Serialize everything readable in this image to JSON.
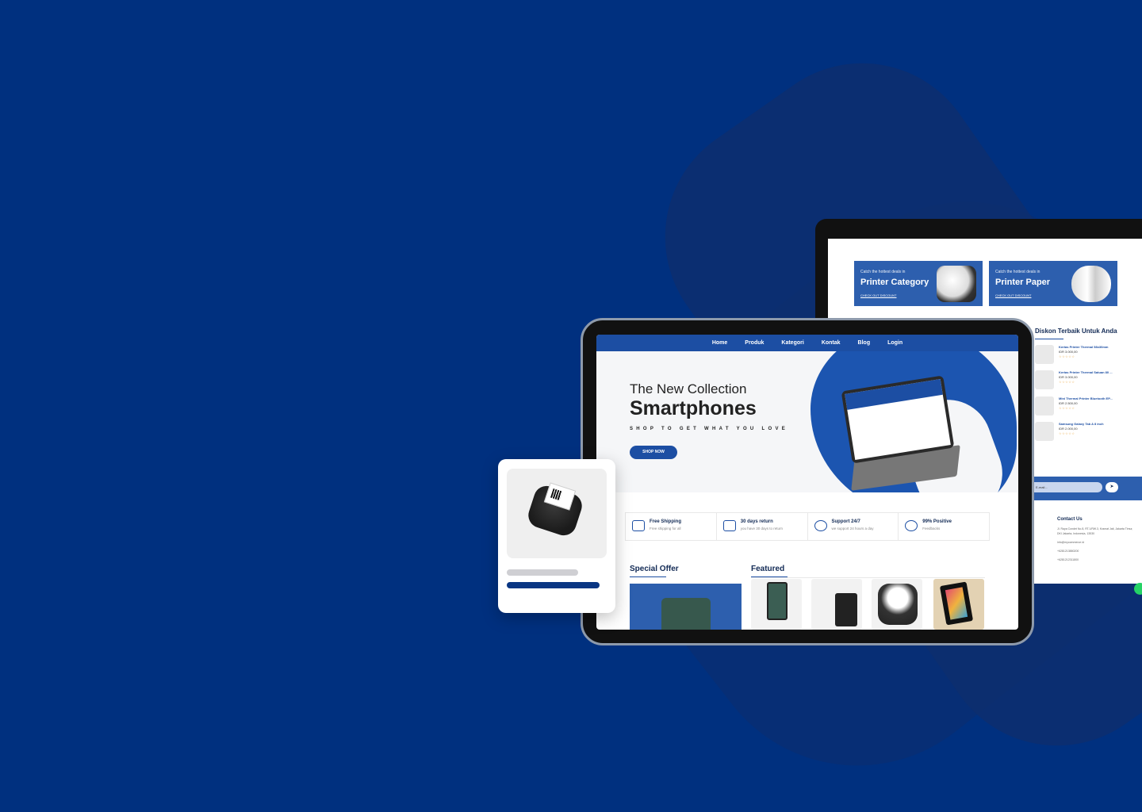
{
  "monitor": {
    "promos": [
      {
        "subtitle": "Catch the hottest deals in",
        "title": "Printer Category",
        "link": "CHECK OUT DISCOUNT"
      },
      {
        "subtitle": "Catch the hottest deals in",
        "title": "Printer Paper",
        "link": "CHECK OUT DISCOUNT"
      }
    ],
    "discount_title": "Diskon Terbaik Untuk Anda",
    "products": [
      {
        "name": "Kertas Printer Thermal 58x30mm",
        "price": "IDR 3.000,00",
        "stars": "☆☆☆☆☆"
      },
      {
        "name": "Kertas Printer Thermal Satuan 80 ...",
        "price": "IDR 3.000,00",
        "stars": "☆☆☆☆☆"
      },
      {
        "name": "Mini Thermal Printer Bluetooth EP...",
        "price": "IDR 2.500,00",
        "stars": "☆☆☆☆☆"
      },
      {
        "name": "Samsung Galaxy Tab A 8 inch",
        "price": "IDR 2.000,00",
        "stars": "☆☆☆☆☆"
      }
    ],
    "newsletter_placeholder": "E-mail...",
    "newsletter_button": "➤",
    "contact": {
      "title": "Contact Us",
      "address": "Jl. Raya Condet No.8, RT.1/RW.3, Kramat Jati, Jakarta Timur, DKI Jakarta, Indonesia, 13530",
      "email": "info@mycommerce.id",
      "phone1": "+6281213880200",
      "phone2": "+6281212311800"
    }
  },
  "tablet": {
    "nav": [
      "Home",
      "Produk",
      "Kategori",
      "Kontak",
      "Blog",
      "Login"
    ],
    "hero": {
      "line1": "The New Collection",
      "line2": "Smartphones",
      "tagline": "SHOP TO GET WHAT YOU LOVE",
      "button": "SHOP NOW"
    },
    "features": [
      {
        "title": "Free Shipping",
        "subtitle": "Free shipping for all",
        "icon": "truck-icon"
      },
      {
        "title": "30 days return",
        "subtitle": "you have 30 days to return",
        "icon": "return-icon"
      },
      {
        "title": "Support 24/7",
        "subtitle": "we support 24 hours a day",
        "icon": "headset-icon"
      },
      {
        "title": "99% Positive",
        "subtitle": "Feedbacks",
        "icon": "feedback-icon"
      }
    ],
    "sections": {
      "special": "Special Offer",
      "featured": "Featured"
    }
  },
  "colors": {
    "background": "#00307f",
    "accent": "#1c4ea3",
    "card_bar": "#093683"
  }
}
